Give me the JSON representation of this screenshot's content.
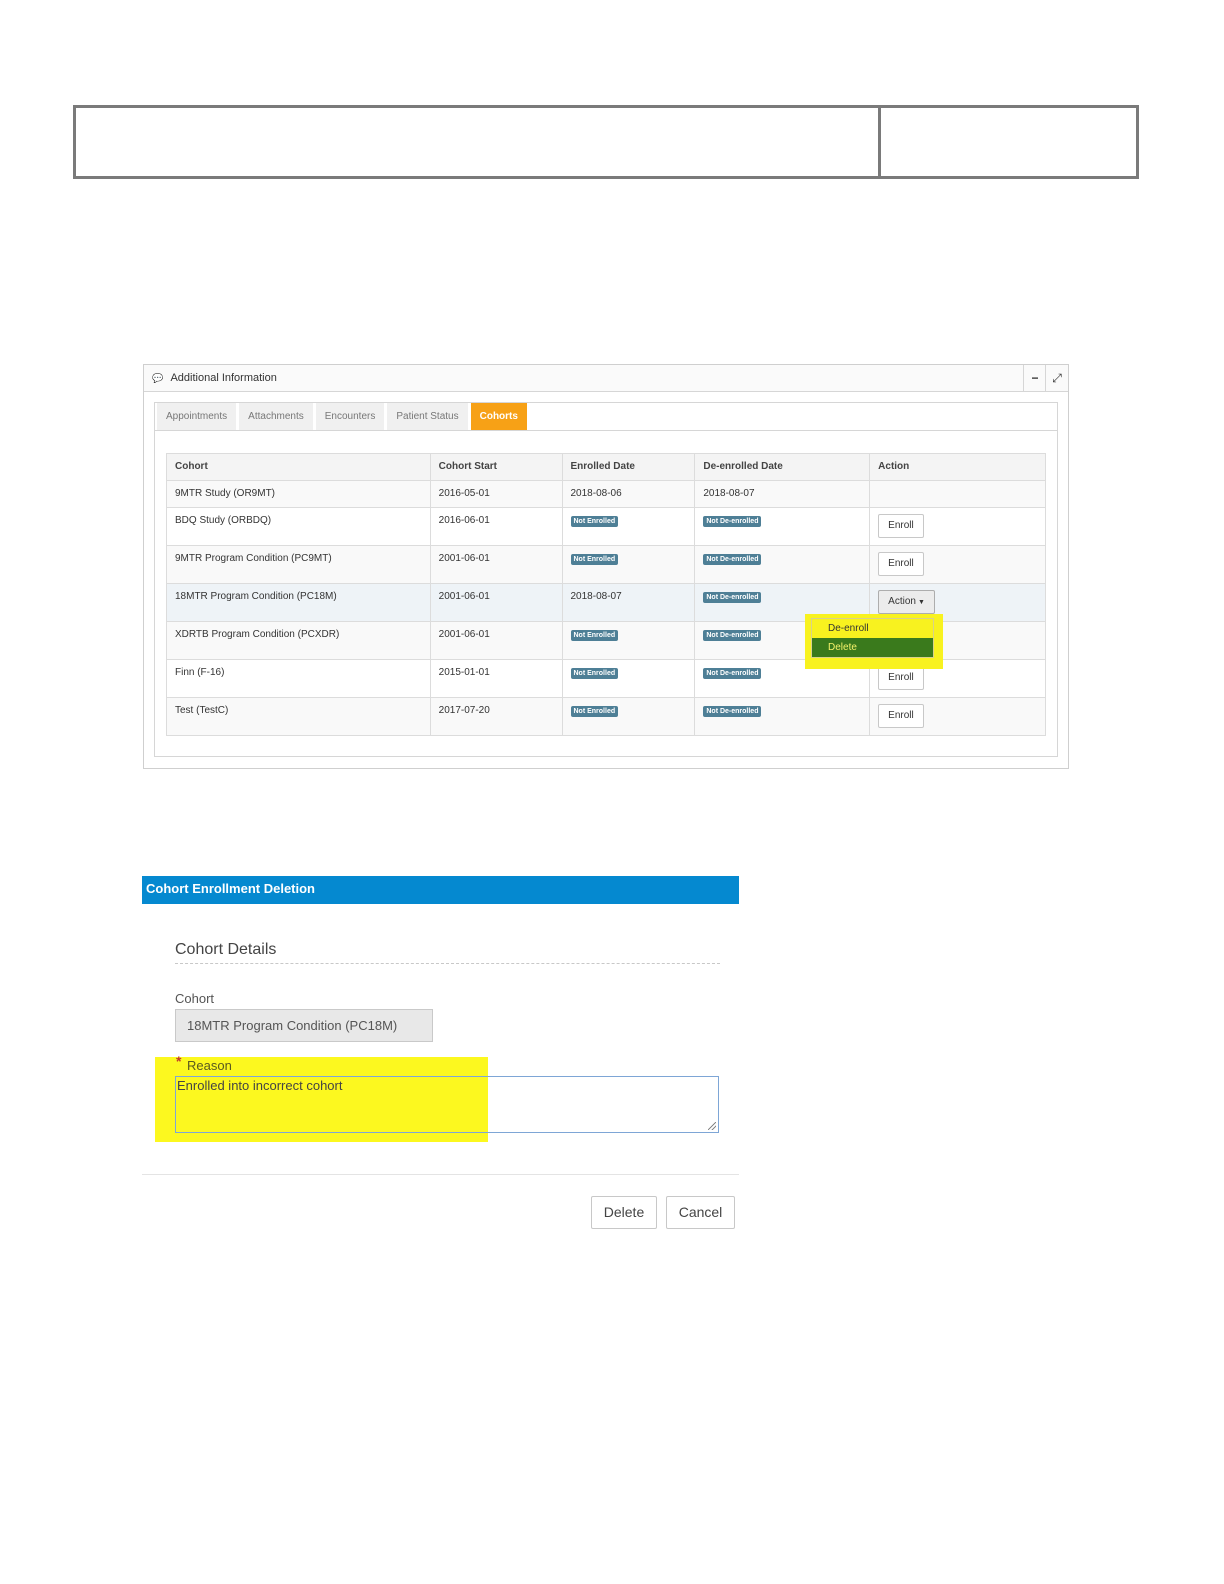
{
  "panel": {
    "title": "Additional Information",
    "tabs": [
      {
        "label": "Appointments"
      },
      {
        "label": "Attachments"
      },
      {
        "label": "Encounters"
      },
      {
        "label": "Patient Status"
      },
      {
        "label": "Cohorts"
      }
    ],
    "active_tab": "Cohorts",
    "minimize_glyph": "−",
    "expand_glyph": "⤢",
    "comments_glyph": "💬"
  },
  "table": {
    "headers": [
      "Cohort",
      "Cohort Start",
      "Enrolled Date",
      "De-enrolled Date",
      "Action"
    ],
    "rows": [
      {
        "cohort": "9MTR Study (OR9MT)",
        "start": "2016-05-01",
        "enrolled": "2018-08-06",
        "deenrolled": "2018-08-07",
        "action": ""
      },
      {
        "cohort": "BDQ Study (ORBDQ)",
        "start": "2016-06-01",
        "enrolled_badge": "Not Enrolled",
        "deenrolled_badge": "Not De-enrolled",
        "action": "Enroll"
      },
      {
        "cohort": "9MTR Program Condition (PC9MT)",
        "start": "2001-06-01",
        "enrolled_badge": "Not Enrolled",
        "deenrolled_badge": "Not De-enrolled",
        "action": "Enroll"
      },
      {
        "cohort": "18MTR Program Condition (PC18M)",
        "start": "2001-06-01",
        "enrolled": "2018-08-07",
        "deenrolled_badge": "Not De-enrolled",
        "action": "Action"
      },
      {
        "cohort": "XDRTB Program Condition (PCXDR)",
        "start": "2001-06-01",
        "enrolled_badge": "Not Enrolled",
        "deenrolled_badge": "Not De-enrolled",
        "action": ""
      },
      {
        "cohort": "Finn (F-16)",
        "start": "2015-01-01",
        "enrolled_badge": "Not Enrolled",
        "deenrolled_badge": "Not De-enrolled",
        "action": "Enroll"
      },
      {
        "cohort": "Test (TestC)",
        "start": "2017-07-20",
        "enrolled_badge": "Not Enrolled",
        "deenrolled_badge": "Not De-enrolled",
        "action": "Enroll"
      }
    ]
  },
  "dropdown": {
    "items": [
      "De-enroll",
      "Delete"
    ],
    "selected": "Delete"
  },
  "dialog": {
    "title": "Cohort Enrollment Deletion",
    "section_title": "Cohort Details",
    "cohort_label": "Cohort",
    "cohort_value": "18MTR Program Condition (PC18M)",
    "required_mark": "*",
    "reason_label": "Reason",
    "reason_value": "Enrolled into incorrect cohort",
    "delete_label": "Delete",
    "cancel_label": "Cancel"
  },
  "colors": {
    "active_tab": "#f7a116",
    "badge": "#4e7f96",
    "dialog_header": "#0589d0",
    "highlight": "#f8f21f",
    "selected_item": "#3a7a1c"
  }
}
